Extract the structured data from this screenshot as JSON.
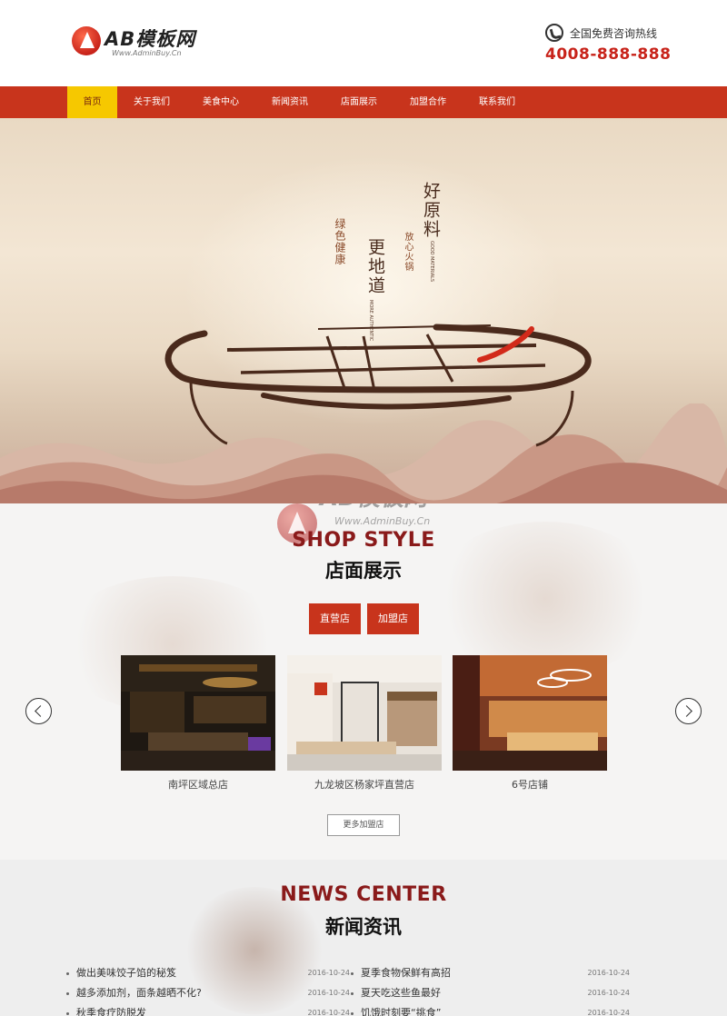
{
  "header": {
    "logo_text": "AB模板网",
    "logo_sub": "Www.AdminBuy.Cn",
    "hotline_label": "全国免费咨询热线",
    "hotline_number": "4008-888-888"
  },
  "nav": {
    "items": [
      "首页",
      "关于我们",
      "美食中心",
      "新闻资讯",
      "店面展示",
      "加盟合作",
      "联系我们"
    ],
    "active_index": 0
  },
  "banner": {
    "lines": [
      "好原料",
      "更地道",
      "绿色健康",
      "放心火锅"
    ],
    "en_lines": [
      "GOOD MATERIALS",
      "MORE AUTHENTIC"
    ]
  },
  "watermark": {
    "text": "AB模板网",
    "sub": "Www.AdminBuy.Cn"
  },
  "shop": {
    "title_en": "SHOP STYLE",
    "title_cn": "店面展示",
    "tabs": [
      "直营店",
      "加盟店"
    ],
    "cards": [
      {
        "caption": "南坪区域总店"
      },
      {
        "caption": "九龙坡区杨家坪直营店"
      },
      {
        "caption": "6号店铺"
      }
    ],
    "more_label": "更多加盟店"
  },
  "news": {
    "title_en": "NEWS CENTER",
    "title_cn": "新闻资讯",
    "left": [
      {
        "title": "做出美味饺子馅的秘笈",
        "date": "2016-10-24"
      },
      {
        "title": "越多添加剂，面条越晒不化?",
        "date": "2016-10-24"
      },
      {
        "title": "秋季食疗防脱发",
        "date": "2016-10-24"
      }
    ],
    "right": [
      {
        "title": "夏季食物保鲜有高招",
        "date": "2016-10-24"
      },
      {
        "title": "夏天吃这些鱼最好",
        "date": "2016-10-24"
      },
      {
        "title": "饥饿时刻要“挑食”",
        "date": "2016-10-24"
      }
    ]
  },
  "colors": {
    "brand_red": "#c8341c",
    "nav_active": "#f6c800",
    "title_dark_red": "#8a1a1a"
  }
}
